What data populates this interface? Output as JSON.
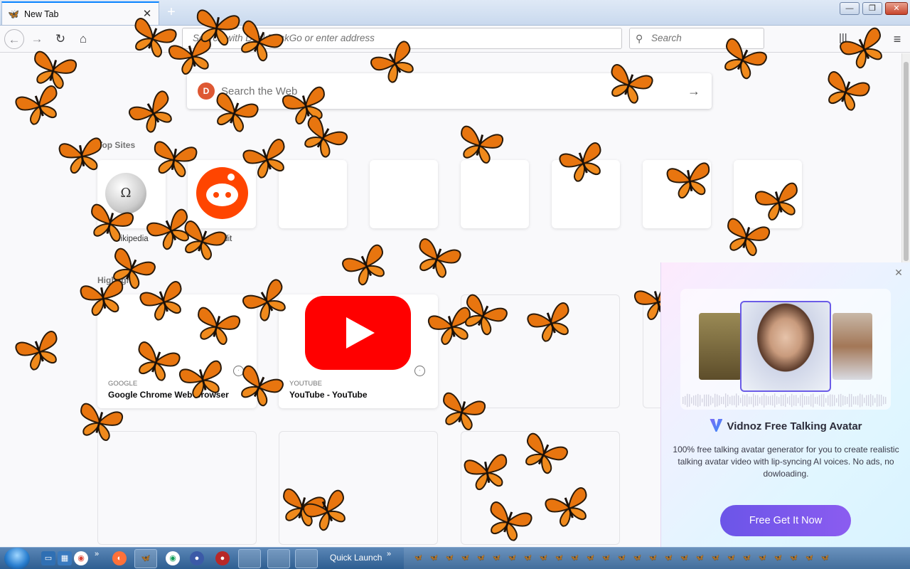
{
  "browser": {
    "tab_title": "New Tab",
    "tab_close": "✕",
    "new_tab": "+",
    "url_placeholder": "Search with DuckDuckGo or enter address",
    "search_placeholder": "Search",
    "controls": {
      "minimize": "—",
      "maximize": "❐",
      "close": "✕"
    }
  },
  "newtab": {
    "search_placeholder": "Search the Web",
    "search_go": "→",
    "top_sites_label": "Top Sites",
    "highlights_label": "Highlights",
    "top_sites": [
      {
        "label": "wikipedia"
      },
      {
        "label": "reddit"
      }
    ],
    "highlights": [
      {
        "source": "GOOGLE",
        "title": "Google Chrome Web Browser"
      },
      {
        "source": "YOUTUBE",
        "title": "YouTube - YouTube"
      }
    ]
  },
  "ad": {
    "close": "✕",
    "brand": "Vidnoz Free Talking Avatar",
    "description": "100% free talking avatar generator for you to create realistic talking avatar video with lip-syncing AI voices. No ads, no dowloading.",
    "cta": "Free Get It Now"
  },
  "taskbar": {
    "quick_launch": "Quick Launch",
    "chevron": "»"
  },
  "colors": {
    "accent": "#0a84ff",
    "reddit": "#ff4500",
    "youtube": "#ff0000",
    "cta": "#6b55e8",
    "butterfly": "#e8750f"
  }
}
